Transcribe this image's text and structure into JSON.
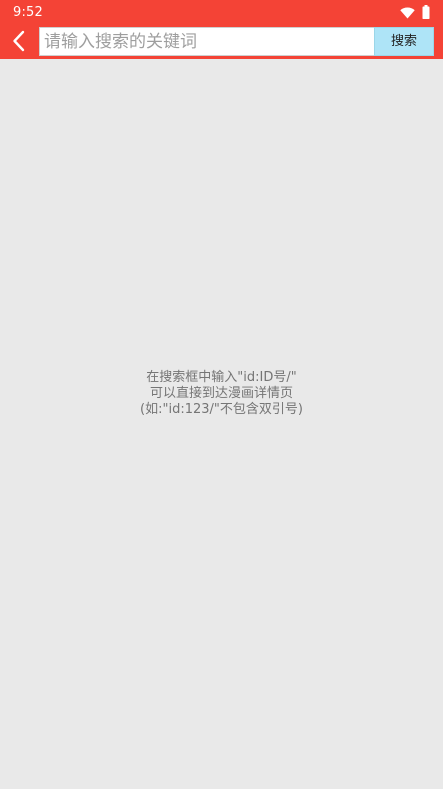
{
  "status_bar": {
    "time": "9:52",
    "icons": [
      "wifi-icon",
      "battery-icon"
    ]
  },
  "toolbar": {
    "back_icon": "chevron-left-icon",
    "search_placeholder": "请输入搜索的关键词",
    "search_value": "",
    "search_button_label": "搜索"
  },
  "hint": {
    "line1": "在搜索框中输入\"id:ID号/\"",
    "line2": "可以直接到达漫画详情页",
    "line3": "(如:\"id:123/\"不包含双引号)"
  },
  "colors": {
    "accent": "#f44336",
    "background": "#e9e9e9",
    "button": "#aee4f7",
    "hint_text": "#757575"
  }
}
